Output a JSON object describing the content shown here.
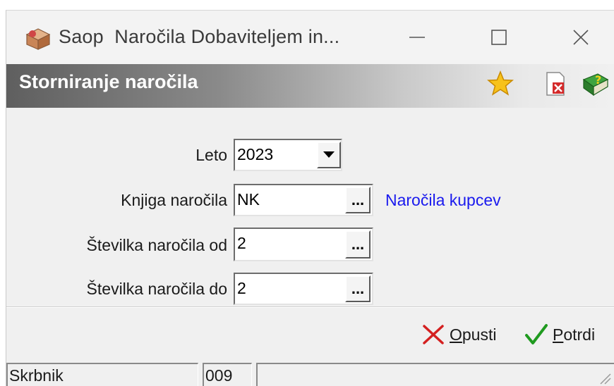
{
  "window": {
    "title": "Saop  Naročila Dobaviteljem in...",
    "app_icon": "box-package-icon",
    "controls": [
      "minimize-icon",
      "maximize-icon",
      "close-icon"
    ]
  },
  "header": {
    "title": "Storniranje naročila",
    "icons": [
      "star-icon",
      "document-delete-icon",
      "help-book-icon"
    ]
  },
  "form": {
    "leto": {
      "label": "Leto",
      "value": "2023"
    },
    "knjiga": {
      "label": "Knjiga naročila",
      "value": "NK",
      "description": "Naročila kupcev"
    },
    "stevilka_od": {
      "label": "Številka naročila od",
      "value": "2"
    },
    "stevilka_do": {
      "label": "Številka naročila do",
      "value": "2"
    },
    "lookup_button_label": "..."
  },
  "actions": {
    "cancel": {
      "underlined": "O",
      "rest": "pusti",
      "icon": "red-x-icon"
    },
    "confirm": {
      "underlined": "P",
      "rest": "otrdi",
      "icon": "green-check-icon"
    }
  },
  "statusbar": {
    "user": "Skrbnik",
    "code": "009"
  },
  "colors": {
    "link": "#1a1aee",
    "header_start": "#5f5f5f",
    "header_end": "#f0f0f0"
  }
}
